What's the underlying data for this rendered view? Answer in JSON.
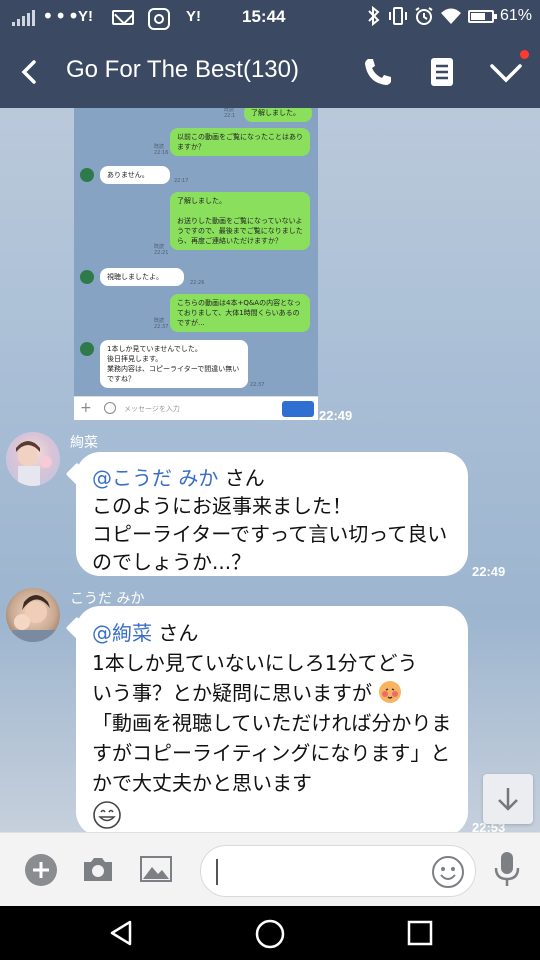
{
  "status_bar": {
    "dots": "•••",
    "yahoo_label": "Y!",
    "yahoo_label_2": "Y!",
    "time": "15:44",
    "battery": "61%"
  },
  "header": {
    "title": "Go For The Best(130)",
    "icons": [
      "back-chevron-icon",
      "phone-icon",
      "note-icon",
      "check-chevron-icon"
    ],
    "bg_color": "#3b4a62"
  },
  "screenshot_message": {
    "time": "22:49",
    "inner": {
      "msg0": "了解しました。",
      "msg0_meta": "既読\n22:1",
      "msg1": "以前この動画をご覧になったことはありますか？",
      "msg1_meta": "既読\n22:16",
      "msg2": "ありません。",
      "msg2_meta": "22:17",
      "msg3": "了解しました。\n\nお送りした動画をご覧になっていないようですので、最後までご覧になりましたら、再度ご連絡いただけますか？",
      "msg3_meta": "既読\n22:21",
      "msg4": "視聴しましたよ。",
      "msg4_meta": "22:26",
      "msg5": "こちらの動画は4本+Q&Aの内容となっておりまして、大体1時間くらいあるのですが...",
      "msg5_meta": "既読\n22:37",
      "msg6": "1本しか見ていませんでした。\n後日拝見します。\n業務内容は、コピーライターで間違い無いですね？",
      "msg6_meta": "22:37",
      "placeholder": "メッセージを入力"
    }
  },
  "messages": [
    {
      "sender": "絢菜",
      "mention": "@こうだ みか",
      "honorific": " さん",
      "text": "このようにお返事来ました！\nコピーライターですって言い切って良いのでしょうか...？",
      "time": "22:49"
    },
    {
      "sender": "こうだ みか",
      "mention": "@絢菜",
      "honorific": " さん",
      "text": "1本しか見ていないにしろ1分てどう\nいう事？とか疑問に思いますが",
      "text2": "「動画を視聴していただければ分かりますがコピーライティングになります」とかで大丈夫かと思います",
      "time": "22:53"
    }
  ],
  "input_bar": {
    "icons": [
      "plus-icon",
      "camera-icon",
      "image-icon",
      "emoji-icon",
      "mic-icon"
    ]
  },
  "nav_bar": {
    "icons": [
      "back-triangle-icon",
      "home-circle-icon",
      "recents-square-icon"
    ]
  },
  "colors": {
    "bubble_green": "#8ae05c",
    "mention_blue": "#3a6fc8"
  }
}
